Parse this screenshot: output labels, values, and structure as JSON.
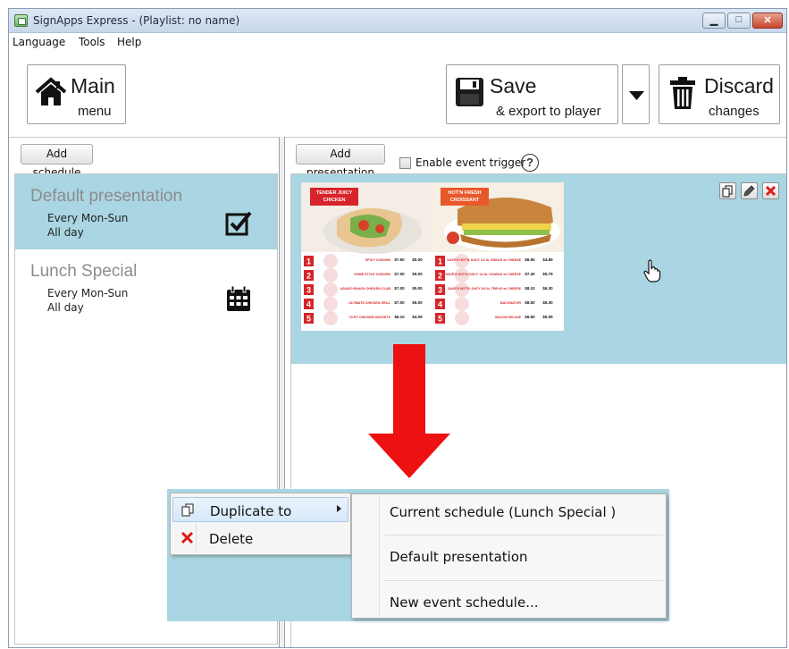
{
  "window": {
    "title": "SignApps Express - (Playlist: no name)",
    "controls": [
      "minimize",
      "maximize",
      "close"
    ]
  },
  "menubar": {
    "items": [
      "Language",
      "Tools",
      "Help"
    ]
  },
  "toolbar": {
    "main": {
      "label": "Main",
      "sublabel": "menu",
      "icon": "home-icon"
    },
    "save": {
      "label": "Save",
      "sublabel": "& export to player",
      "icon": "floppy-disk-icon"
    },
    "discard": {
      "label": "Discard",
      "sublabel": "changes",
      "icon": "trash-icon"
    }
  },
  "left_panel": {
    "add_button": "Add schedule",
    "schedules": [
      {
        "title": "Default presentation",
        "line1": "Every Mon-Sun",
        "line2": "All day",
        "icon": "checked-box-icon",
        "selected": true
      },
      {
        "title": "Lunch Special",
        "line1": "Every Mon-Sun",
        "line2": "All day",
        "icon": "calendar-icon",
        "selected": false
      }
    ]
  },
  "right_panel": {
    "add_button": "Add presentation",
    "event_trigger_label": "Enable event trigger",
    "event_trigger_checked": false,
    "help": "?",
    "presentation_tools": [
      "duplicate-icon",
      "edit-icon",
      "delete-icon"
    ]
  },
  "thumbnail": {
    "left_header": "TENDER JUICY CHICKEN",
    "right_header": "HOT'N FRESH CROISSANT",
    "left_items": [
      {
        "num": "1",
        "name": "SPICY CHICKEN",
        "p1": "$7.60",
        "p2": "$5.00"
      },
      {
        "num": "2",
        "name": "HOME STYLE CHICKEN",
        "p1": "$7.00",
        "p2": "$5.00"
      },
      {
        "num": "3",
        "name": "ASIAGO RANCH CHICKEN CLUB",
        "p1": "$7.00",
        "p2": "$5.00"
      },
      {
        "num": "4",
        "name": "ULTIMATE CHICKEN GRILL",
        "p1": "$7.00",
        "p2": "$5.00"
      },
      {
        "num": "5",
        "name": "10-PC CHICKEN NUGGETS",
        "p1": "$6.10",
        "p2": "$4.09"
      }
    ],
    "right_items": [
      {
        "num": "1",
        "name": "DAVE'S HOT'N JUICY 1/4 lb. SINGLE w/ CHEESE",
        "p1": "$6.90",
        "p2": "$4.89"
      },
      {
        "num": "2",
        "name": "DAVE'S HOT'N JUICY 1/2 lb. DOUBLE w/ CHEESE",
        "p1": "$7.40",
        "p2": "$5.79"
      },
      {
        "num": "3",
        "name": "DAVE'S HOT'N JUICY 3/4 lb. TRIPLE w/ CHEESE",
        "p1": "$8.10",
        "p2": "$6.30"
      },
      {
        "num": "4",
        "name": "BACONATOR",
        "p1": "$8.50",
        "p2": "$6.30"
      },
      {
        "num": "5",
        "name": "BACON DELUXE",
        "p1": "$6.50",
        "p2": "$5.09"
      }
    ]
  },
  "context_menu": {
    "items": [
      {
        "label": "Duplicate to",
        "icon": "duplicate-icon",
        "has_submenu": true
      },
      {
        "label": "Delete",
        "icon": "red-x-icon",
        "has_submenu": false
      }
    ],
    "submenu": [
      "Current schedule (Lunch Special )",
      "Default presentation",
      "New event schedule..."
    ]
  },
  "colors": {
    "selection": "#aad5e2",
    "arrow": "#ee1111",
    "brand_red": "#d6242a"
  }
}
